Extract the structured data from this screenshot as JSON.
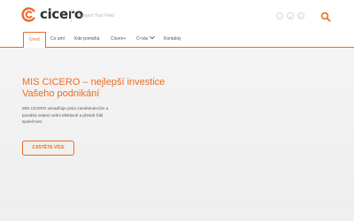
{
  "brand": {
    "name": "cicero",
    "accent_color": "#ef6a22",
    "logo_icon": "cicero-logo-icon"
  },
  "header": {
    "tagline": "Support Your Field",
    "social_icons": [
      "facebook-icon",
      "google-plus-icon",
      "linkedin-icon"
    ],
    "search_icon": "search-icon"
  },
  "nav": {
    "items": [
      {
        "label": "Úvod",
        "active": true
      },
      {
        "label": "Co umí"
      },
      {
        "label": "Kde pomáhá"
      },
      {
        "label": "Cicero+"
      },
      {
        "label": "O nás",
        "has_dropdown": true
      },
      {
        "label": "Kontakty"
      }
    ]
  },
  "hero": {
    "title_line1": "MIS CICERO – nejlepší investice",
    "title_line2": "Vašeho podnikání",
    "text": "MIS CICERO usnadňuje práci zaměstnancům a pomáhá vedení velmi efektivně a přesně řídit společnost.",
    "button_label": "ZJISTĚTE VÍCE"
  }
}
